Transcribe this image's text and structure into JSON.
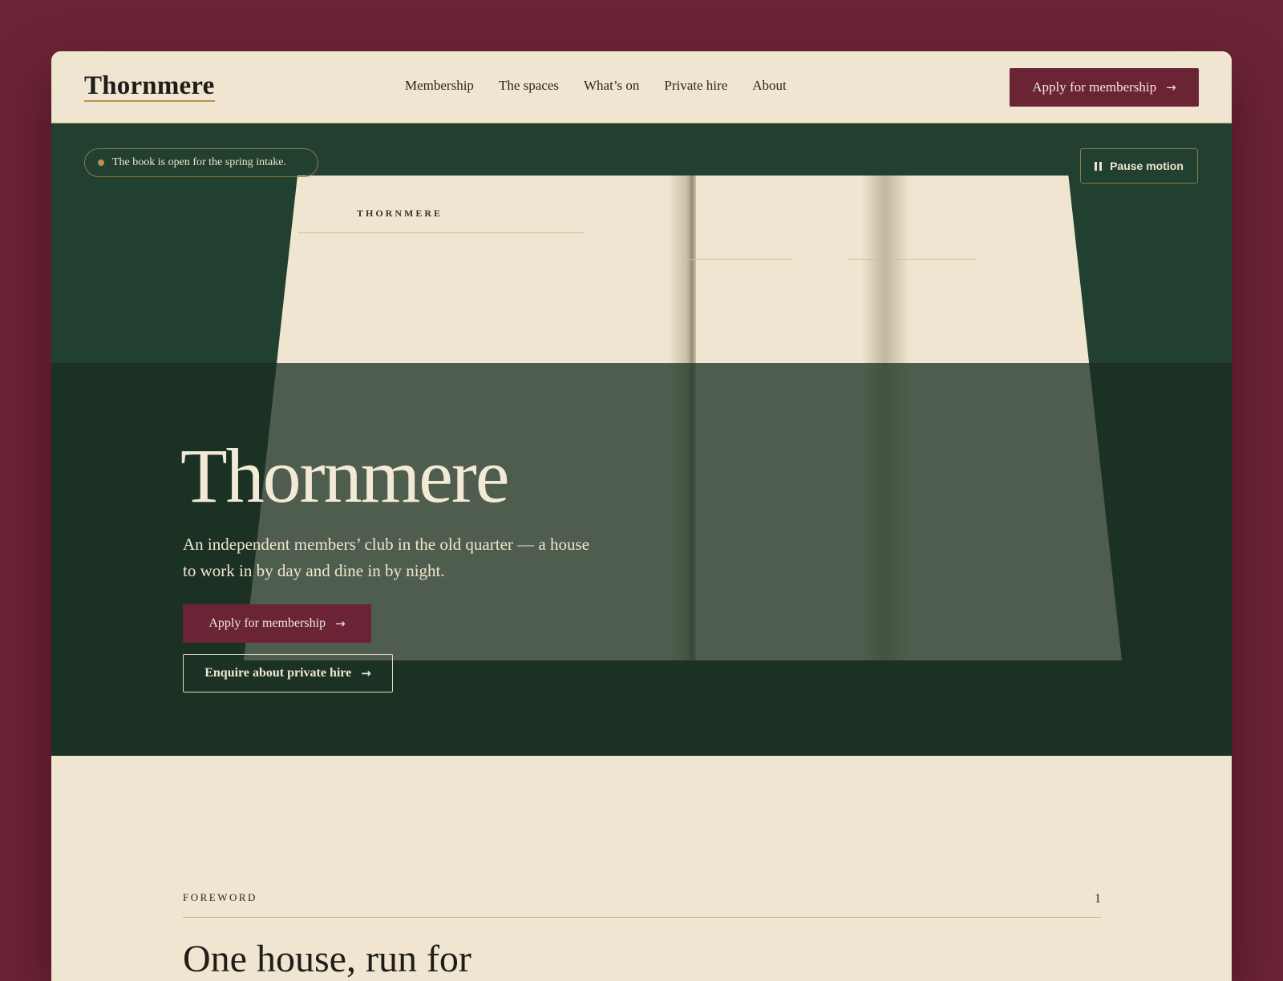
{
  "header": {
    "logo": "Thornmere",
    "nav": [
      "Membership",
      "The spaces",
      "What’s on",
      "Private hire",
      "About"
    ],
    "cta_label": "Apply for membership"
  },
  "hero": {
    "badge_text": "The book is open for the spring intake.",
    "pause_label": "Pause motion",
    "book_brand": "THORNMERE",
    "title": "Thornmere",
    "subtitle": "An independent members’ club in the old quarter — a house to work in by day and dine in by night.",
    "primary_cta": "Apply for membership",
    "secondary_cta": "Enquire about private hire"
  },
  "foreword": {
    "label": "FOREWORD",
    "page_number": "1",
    "heading": "One house, run for the people in it"
  },
  "icons": {
    "arrow": "arrow-right-icon",
    "pause": "pause-icon",
    "status_dot": "status-dot-icon"
  },
  "colors": {
    "background": "#6b2436",
    "paper": "#efe5d0",
    "forest": "#1a3022",
    "brass": "#b8904c",
    "wine": "#6b2436"
  }
}
